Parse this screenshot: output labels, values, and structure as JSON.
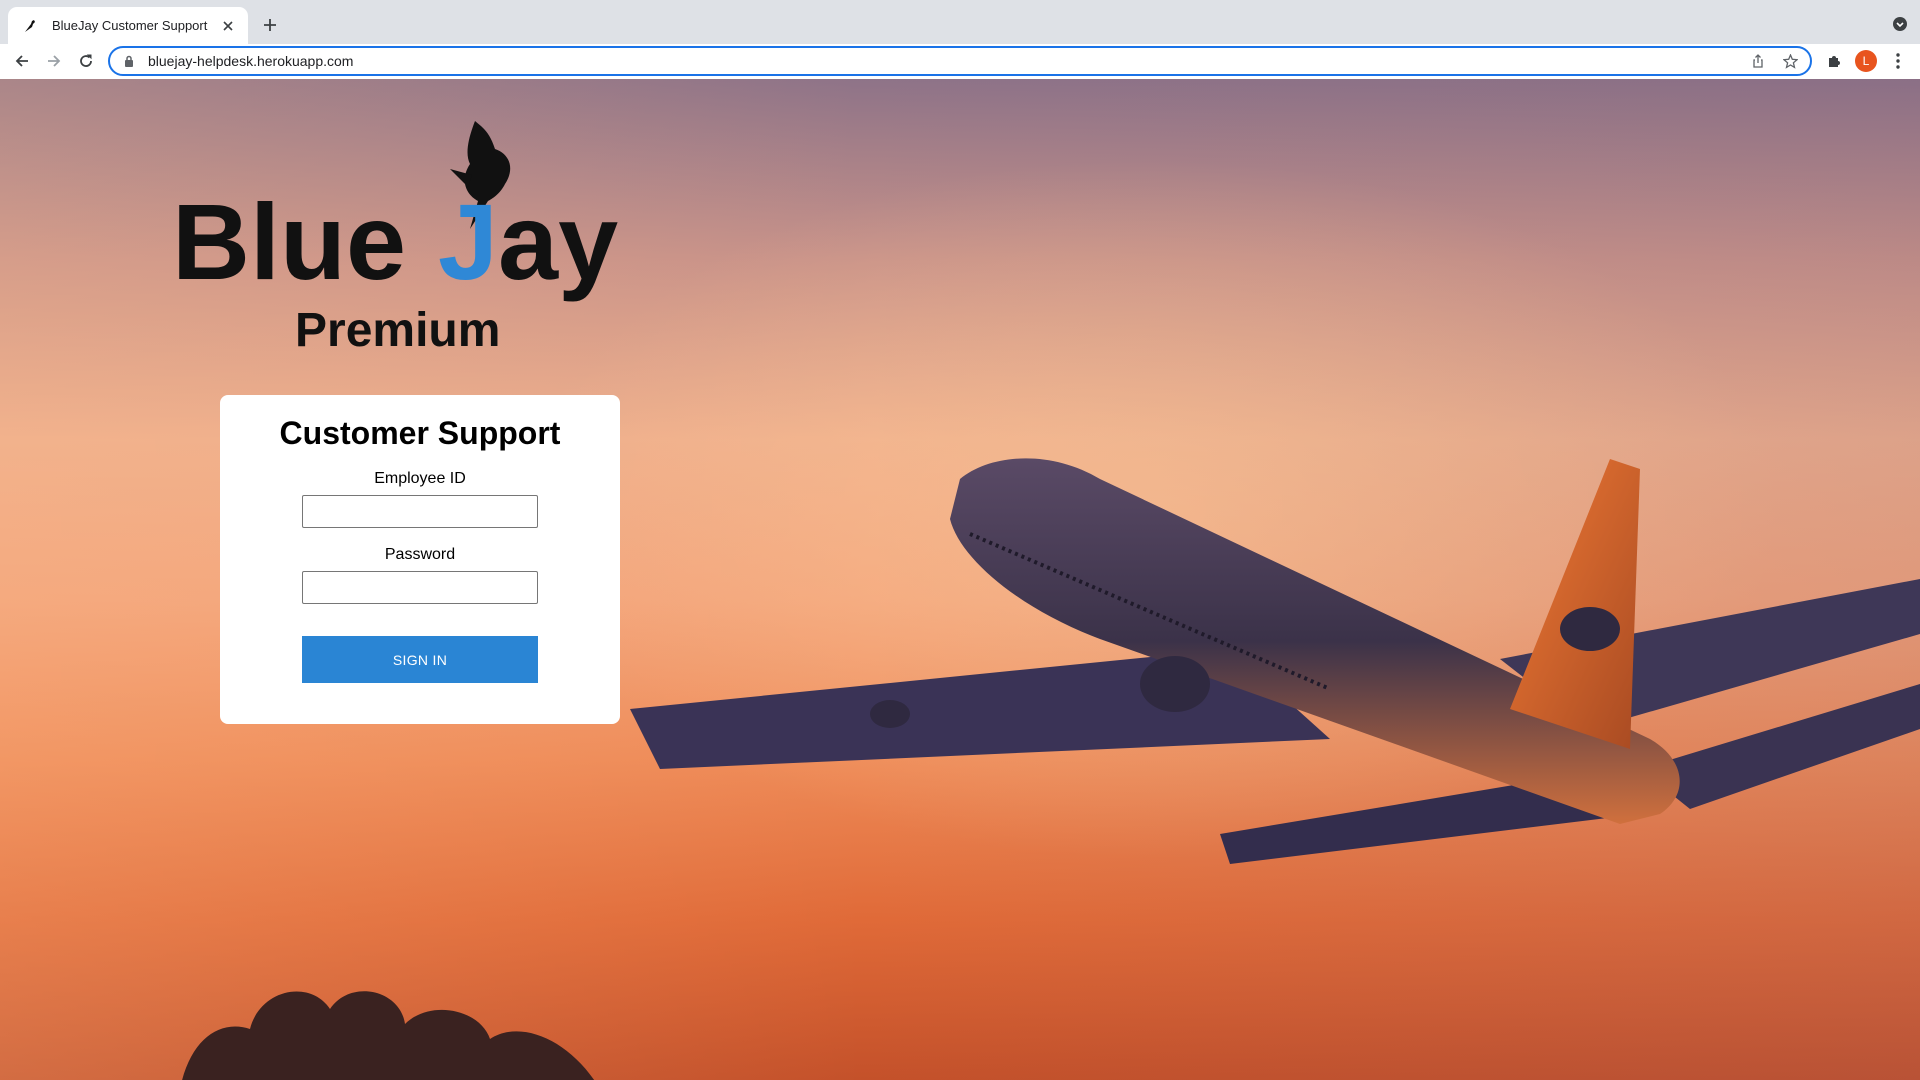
{
  "browser": {
    "tab_title": "BlueJay Customer Support",
    "url": "bluejay-helpdesk.herokuapp.com",
    "profile_initial": "L",
    "icons": [
      "favicon-bird-icon",
      "close-icon",
      "plus-icon",
      "tab-search-icon",
      "back-icon",
      "forward-icon",
      "reload-icon",
      "lock-icon",
      "share-icon",
      "star-icon",
      "extensions-icon",
      "kebab-menu-icon"
    ]
  },
  "logo": {
    "word_blue": "Blue",
    "word_j": "J",
    "word_ay": "ay",
    "subtitle": "Premium",
    "accent_color": "#2f88d6"
  },
  "login": {
    "title": "Customer Support",
    "employee_id_label": "Employee ID",
    "employee_id_value": "",
    "password_label": "Password",
    "password_value": "",
    "submit_label": "SIGN IN",
    "button_color": "#2a85d4"
  }
}
